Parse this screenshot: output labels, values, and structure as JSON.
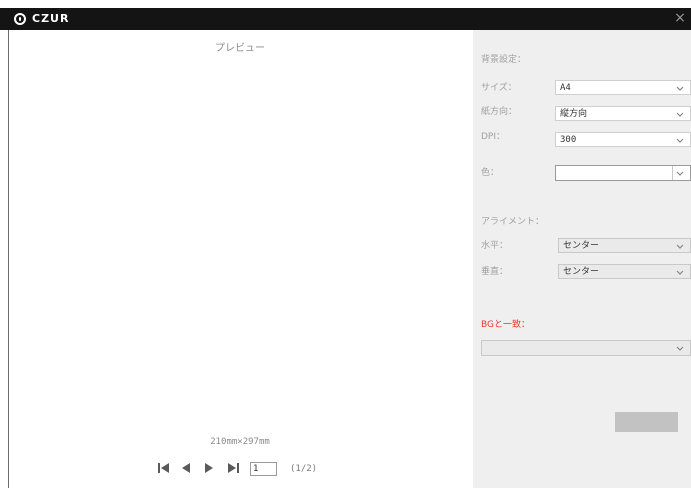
{
  "window": {
    "app_name": "CZUR",
    "close_glyph": "×"
  },
  "preview": {
    "title": "プレビュー",
    "paper_size": "210mm×297mm",
    "page_input": "1",
    "page_count": "(1/2)"
  },
  "settings": {
    "background_header": "背景設定：",
    "size_label": "サイズ：",
    "size_value": "A4",
    "orientation_label": "紙方向：",
    "orientation_value": "縦方向",
    "dpi_label": "DPI：",
    "dpi_value": "300",
    "color_label": "色：",
    "alignment_header": "アライメント：",
    "horizontal_label": "水平：",
    "horizontal_value": "センター",
    "vertical_label": "垂直：",
    "vertical_value": "センター",
    "match_bg_label": "BGと一致：",
    "match_bg_value": "",
    "ok_button": "",
    "accent_color": "#e8352a"
  },
  "icons": [
    "logo-icon",
    "close-icon",
    "first-page-icon",
    "prev-page-icon",
    "next-page-icon",
    "last-page-icon",
    "chevron-down-icon"
  ]
}
